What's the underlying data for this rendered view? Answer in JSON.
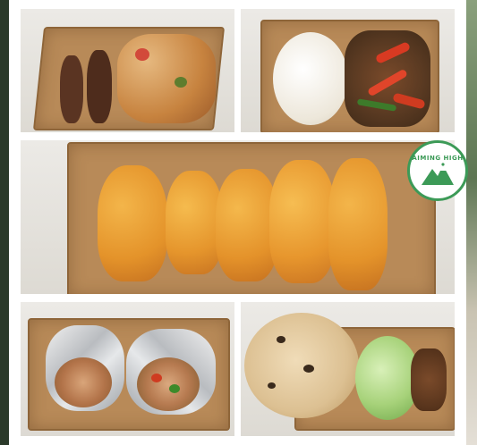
{
  "badge": {
    "text": "AIMING HIGH",
    "icon": "mountain-icon",
    "color": "#3c9a57"
  },
  "colors": {
    "cardboard": "#b88a58",
    "frame": "#ffffff",
    "accent_green": "#3c9a57"
  },
  "photos": [
    {
      "subject": "kofta-with-roast-potatoes"
    },
    {
      "subject": "rice-with-stir-fry-vegetables"
    },
    {
      "subject": "breaded-fish-pieces"
    },
    {
      "subject": "foil-wrapped-burrito"
    },
    {
      "subject": "flatbread-with-salad"
    }
  ]
}
